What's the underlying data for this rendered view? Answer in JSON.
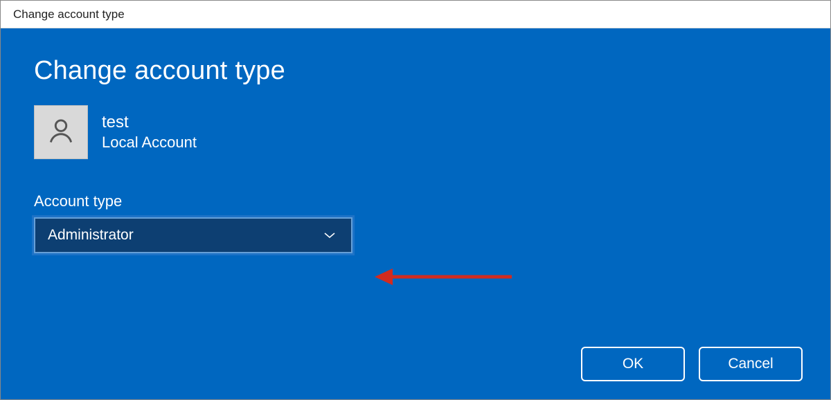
{
  "window": {
    "title": "Change account type"
  },
  "dialog": {
    "heading": "Change account type",
    "user": {
      "name": "test",
      "kind": "Local Account"
    },
    "field_label": "Account type",
    "dropdown": {
      "selected": "Administrator"
    },
    "buttons": {
      "ok": "OK",
      "cancel": "Cancel"
    }
  },
  "colors": {
    "accent": "#0067c0",
    "dropdown_bg": "#0d3f72",
    "dropdown_border": "#66a0d8",
    "annotation": "#d22b1f"
  }
}
